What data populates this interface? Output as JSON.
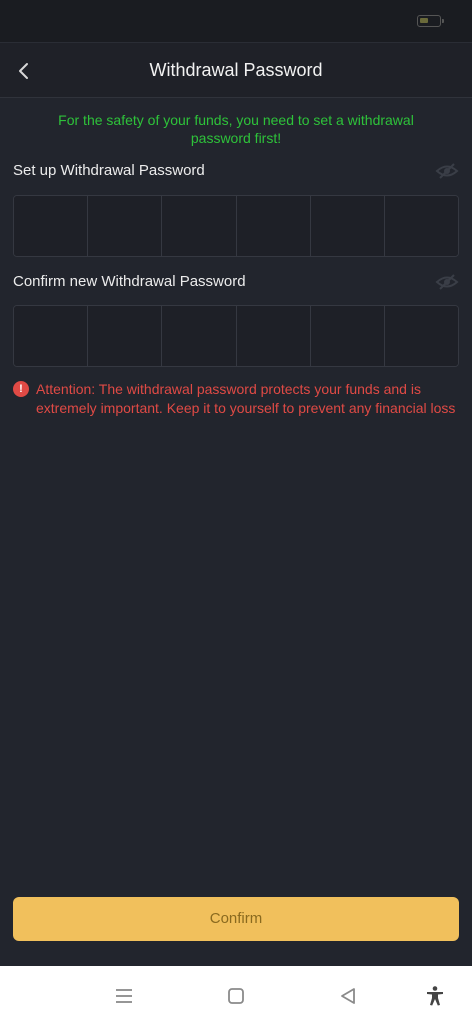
{
  "header": {
    "title": "Withdrawal Password",
    "back_icon": "chevron-left-icon"
  },
  "notice": "For the safety of your funds, you need to set a withdrawal password first!",
  "setup": {
    "label": "Set up Withdrawal Password",
    "visibility_icon": "eye-off-icon",
    "digits": [
      "",
      "",
      "",
      "",
      "",
      ""
    ]
  },
  "confirm_new": {
    "label": "Confirm new Withdrawal Password",
    "visibility_icon": "eye-off-icon",
    "digits": [
      "",
      "",
      "",
      "",
      "",
      ""
    ]
  },
  "attention": {
    "icon": "alert-icon",
    "icon_glyph": "!",
    "text": "Attention: The withdrawal password protects your funds and is extremely important. Keep it to yourself to prevent any financial loss"
  },
  "confirm_button": {
    "label": "Confirm"
  },
  "navigation": [
    "menu-icon",
    "home-square-icon",
    "back-triangle-icon",
    "accessibility-icon"
  ],
  "colors": {
    "background": "#22252d",
    "notice_green": "#2ec23a",
    "warning_red": "#e04a45",
    "button_yellow": "#f1c05c",
    "button_text": "#8a6a1f"
  }
}
